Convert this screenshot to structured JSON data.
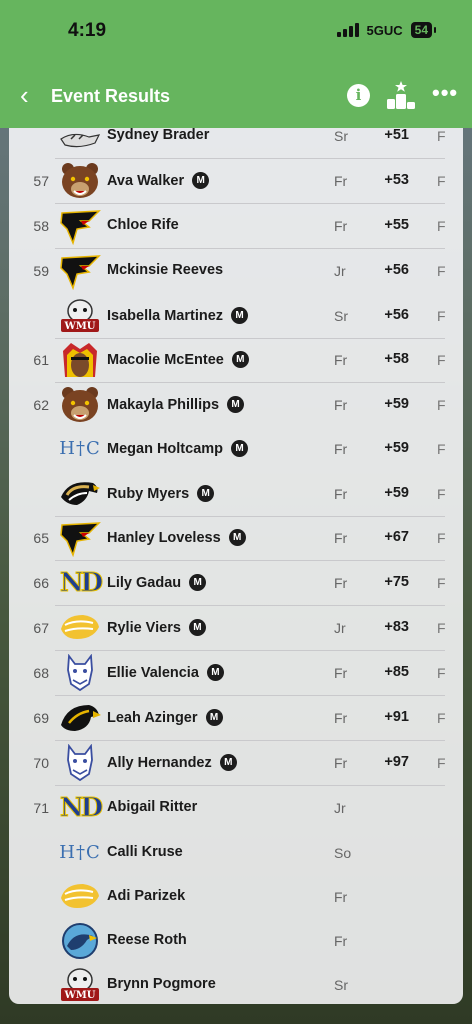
{
  "status": {
    "time": "4:19",
    "network": "5GUC",
    "battery": "54"
  },
  "header": {
    "title": "Event Results",
    "back_glyph": "‹",
    "info_glyph": "i",
    "more_glyph": "•••"
  },
  "players": [
    {
      "pos": "",
      "name": "Sydney Brader",
      "badge": false,
      "logo": "kirksville-tiger",
      "year": "Sr",
      "score": "+51",
      "status": "F"
    },
    {
      "pos": "57",
      "name": "Ava Walker",
      "badge": true,
      "logo": "bear",
      "year": "Fr",
      "score": "+53",
      "status": "F"
    },
    {
      "pos": "58",
      "name": "Chloe Rife",
      "badge": false,
      "logo": "falcon",
      "year": "Fr",
      "score": "+55",
      "status": "F"
    },
    {
      "pos": "59",
      "name": "Mckinsie Reeves",
      "badge": false,
      "logo": "falcon",
      "year": "Jr",
      "score": "+56",
      "status": "F"
    },
    {
      "pos": "",
      "name": "Isabella Martinez",
      "badge": true,
      "logo": "wmu",
      "year": "Sr",
      "score": "+56",
      "status": "F"
    },
    {
      "pos": "61",
      "name": "Macolie McEntee",
      "badge": true,
      "logo": "chief",
      "year": "Fr",
      "score": "+58",
      "status": "F"
    },
    {
      "pos": "62",
      "name": "Makayla Phillips",
      "badge": true,
      "logo": "bear",
      "year": "Fr",
      "score": "+59",
      "status": "F"
    },
    {
      "pos": "",
      "name": "Megan Holtcamp",
      "badge": true,
      "logo": "htc",
      "year": "Fr",
      "score": "+59",
      "status": "F"
    },
    {
      "pos": "",
      "name": "Ruby Myers",
      "badge": true,
      "logo": "eagle-gold",
      "year": "Fr",
      "score": "+59",
      "status": "F"
    },
    {
      "pos": "65",
      "name": "Hanley Loveless",
      "badge": true,
      "logo": "falcon",
      "year": "Fr",
      "score": "+67",
      "status": "F"
    },
    {
      "pos": "66",
      "name": "Lily Gadau",
      "badge": true,
      "logo": "nd",
      "year": "Fr",
      "score": "+75",
      "status": "F"
    },
    {
      "pos": "67",
      "name": "Rylie Viers",
      "badge": true,
      "logo": "gold-head",
      "year": "Jr",
      "score": "+83",
      "status": "F"
    },
    {
      "pos": "68",
      "name": "Ellie Valencia",
      "badge": true,
      "logo": "wildcat",
      "year": "Fr",
      "score": "+85",
      "status": "F"
    },
    {
      "pos": "69",
      "name": "Leah Azinger",
      "badge": true,
      "logo": "hawk",
      "year": "Fr",
      "score": "+91",
      "status": "F"
    },
    {
      "pos": "70",
      "name": "Ally Hernandez",
      "badge": true,
      "logo": "wildcat",
      "year": "Fr",
      "score": "+97",
      "status": "F"
    },
    {
      "pos": "71",
      "name": "Abigail Ritter",
      "badge": false,
      "logo": "nd",
      "year": "Jr",
      "score": "",
      "status": ""
    },
    {
      "pos": "",
      "name": "Calli Kruse",
      "badge": false,
      "logo": "htc",
      "year": "So",
      "score": "",
      "status": ""
    },
    {
      "pos": "",
      "name": "Adi Parizek",
      "badge": false,
      "logo": "gold-head",
      "year": "Fr",
      "score": "",
      "status": ""
    },
    {
      "pos": "",
      "name": "Reese Roth",
      "badge": false,
      "logo": "blue-eagle",
      "year": "Fr",
      "score": "",
      "status": ""
    },
    {
      "pos": "",
      "name": "Brynn Pogmore",
      "badge": false,
      "logo": "wmu",
      "year": "Sr",
      "score": "",
      "status": ""
    }
  ],
  "logo_text": {
    "htc": "H†C",
    "nd": "ND",
    "wmu": "WMU"
  },
  "badge_text": "M",
  "colors": {
    "brand_green": "#66b55e"
  }
}
